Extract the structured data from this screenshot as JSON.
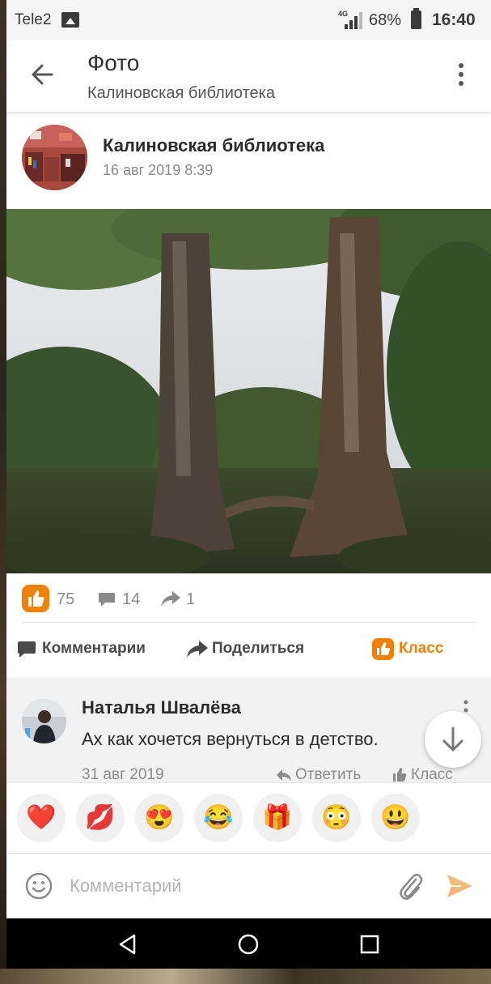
{
  "status_bar": {
    "carrier": "Tele2",
    "network": "4G",
    "battery": "68%",
    "time": "16:40",
    "icons": [
      "gallery-icon",
      "signal-icon",
      "battery-icon"
    ]
  },
  "app_bar": {
    "title": "Фото",
    "subtitle": "Калиновская библиотека",
    "icons": [
      "back-arrow-icon",
      "more-vertical-icon"
    ]
  },
  "post": {
    "author": "Калиновская библиотека",
    "date": "16 авг 2019 8:39",
    "stats": {
      "likes": "75",
      "comments": "14",
      "shares": "1"
    }
  },
  "actions": {
    "comments": "Комментарии",
    "share": "Поделиться",
    "class": "Класс"
  },
  "comment": {
    "author": "Наталья Швалёва",
    "text": "Ах как хочется вернуться в детство.",
    "date": "31 авг 2019",
    "reply": "Ответить",
    "class": "Класс"
  },
  "reactions": [
    {
      "name": "heart",
      "glyph": "❤️"
    },
    {
      "name": "kiss",
      "glyph": "💋"
    },
    {
      "name": "heart-eyes",
      "glyph": "😍"
    },
    {
      "name": "laughing",
      "glyph": "😂"
    },
    {
      "name": "gift",
      "glyph": "🎁"
    },
    {
      "name": "flushed",
      "glyph": "😳"
    },
    {
      "name": "smiley",
      "glyph": "😃"
    }
  ],
  "input": {
    "placeholder": "Комментарий"
  },
  "colors": {
    "accent": "#ee8208",
    "text": "#2b2b2b",
    "muted": "#8a8a8a"
  }
}
